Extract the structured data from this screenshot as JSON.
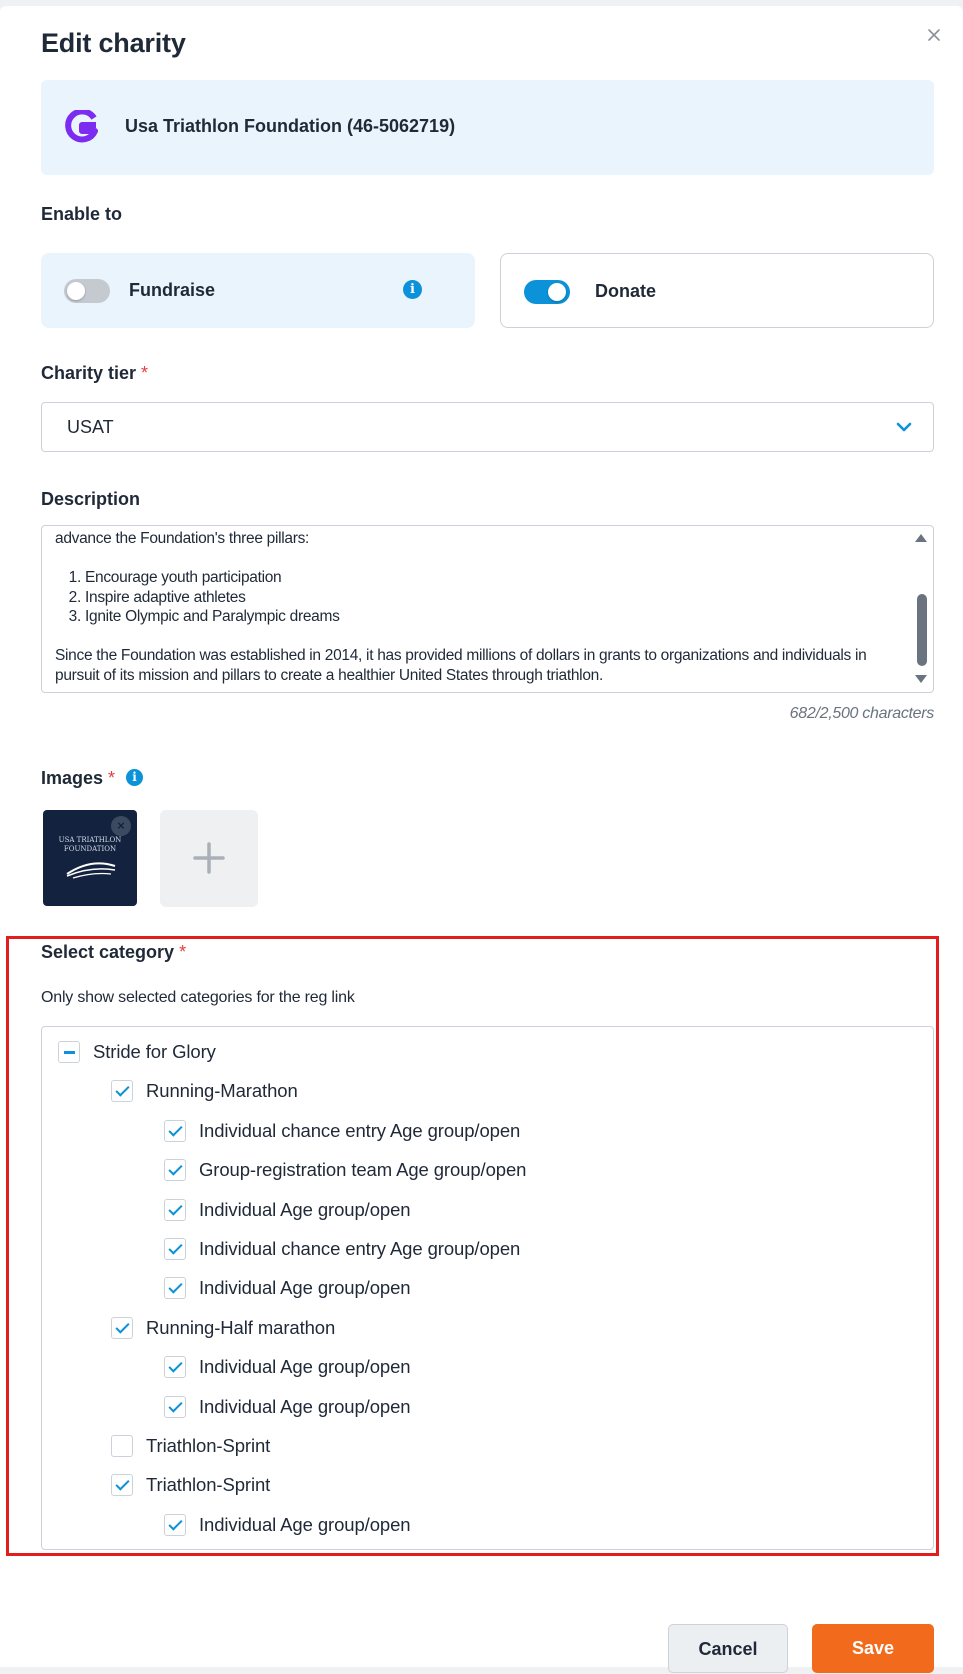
{
  "modal": {
    "title": "Edit charity"
  },
  "charity": {
    "name": "Usa Triathlon Foundation (46-5062719)"
  },
  "enable_to": {
    "label": "Enable to",
    "fundraise": {
      "label": "Fundraise",
      "enabled": false
    },
    "donate": {
      "label": "Donate",
      "enabled": true
    }
  },
  "charity_tier": {
    "label": "Charity tier",
    "required_mark": "*",
    "value": "USAT"
  },
  "description": {
    "label": "Description",
    "line1": "advance the Foundation's three pillars:",
    "pillars": [
      "Encourage youth participation",
      "Inspire adaptive athletes",
      "Ignite Olympic and Paralympic dreams"
    ],
    "paragraph": "Since the Foundation was established in 2014, it has provided millions of dollars in grants to organizations and individuals in pursuit of its mission and pillars to create a healthier United States through triathlon.",
    "counter": "682/2,500 characters"
  },
  "images": {
    "label": "Images",
    "required_mark": "*",
    "thumbnail_text": "USA TRIATHLON FOUNDATION"
  },
  "category": {
    "label": "Select category",
    "required_mark": "*",
    "hint": "Only show selected categories for the reg link",
    "tree": [
      {
        "label": "Stride for Glory",
        "state": "partial",
        "level": 0
      },
      {
        "label": "Running-Marathon",
        "state": "checked",
        "level": 1
      },
      {
        "label": "Individual chance entry Age group/open",
        "state": "checked",
        "level": 2
      },
      {
        "label": "Group-registration team Age group/open",
        "state": "checked",
        "level": 2
      },
      {
        "label": "Individual Age group/open",
        "state": "checked",
        "level": 2
      },
      {
        "label": "Individual chance entry Age group/open",
        "state": "checked",
        "level": 2
      },
      {
        "label": "Individual Age group/open",
        "state": "checked",
        "level": 2
      },
      {
        "label": "Running-Half marathon",
        "state": "checked",
        "level": 1
      },
      {
        "label": "Individual Age group/open",
        "state": "checked",
        "level": 2
      },
      {
        "label": "Individual Age group/open",
        "state": "checked",
        "level": 2
      },
      {
        "label": "Triathlon-Sprint",
        "state": "unchecked",
        "level": 1
      },
      {
        "label": "Triathlon-Sprint",
        "state": "checked",
        "level": 1
      },
      {
        "label": "Individual Age group/open",
        "state": "checked",
        "level": 2
      }
    ]
  },
  "actions": {
    "cancel": "Cancel",
    "save": "Save"
  },
  "colors": {
    "accent": "#0b92d9",
    "save": "#f26b1d",
    "highlight": "#e11d1d",
    "charity_card": "#eaf4fd"
  }
}
